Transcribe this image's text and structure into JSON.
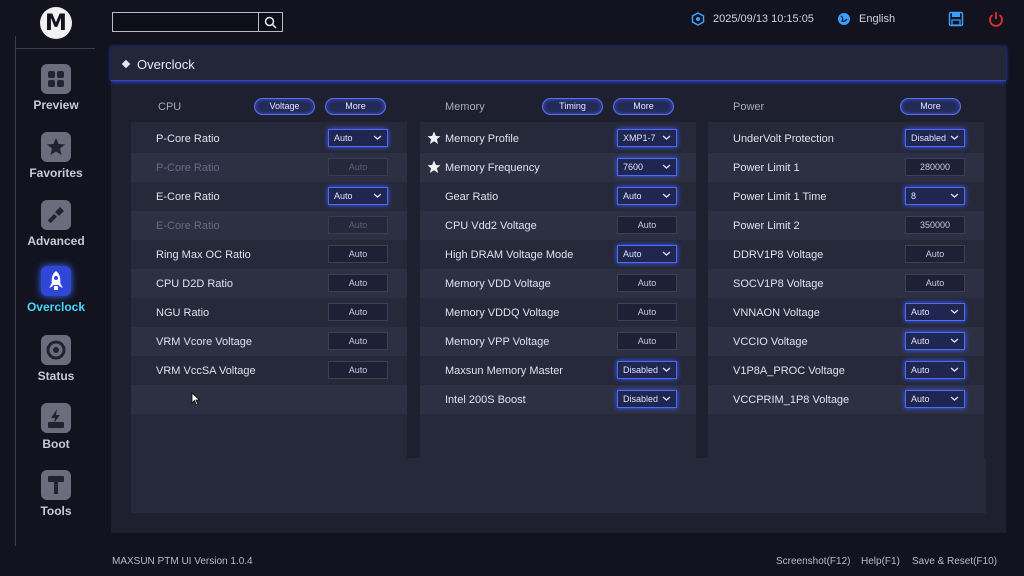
{
  "logo": "M",
  "sidebar": {
    "items": [
      {
        "label": "Preview",
        "icon": "grid-icon"
      },
      {
        "label": "Favorites",
        "icon": "star-icon"
      },
      {
        "label": "Advanced",
        "icon": "wrench-icon"
      },
      {
        "label": "Overclock",
        "icon": "rocket-icon",
        "active": true
      },
      {
        "label": "Status",
        "icon": "gauge-icon"
      },
      {
        "label": "Boot",
        "icon": "ssd-icon"
      },
      {
        "label": "Tools",
        "icon": "tools-icon"
      }
    ]
  },
  "search": {
    "value": "",
    "placeholder": ""
  },
  "header": {
    "datetime": "2025/09/13 10:15:05",
    "language": "English"
  },
  "main": {
    "title": "Overclock"
  },
  "columns": {
    "cpu": {
      "title": "CPU",
      "buttons": [
        "Voltage",
        "More"
      ],
      "rows": [
        {
          "label": "P-Core Ratio",
          "value": "Auto",
          "type": "select",
          "dim": false
        },
        {
          "label": "P-Core Ratio",
          "value": "Auto",
          "type": "field",
          "dim": true
        },
        {
          "label": "E-Core Ratio",
          "value": "Auto",
          "type": "select",
          "dim": false
        },
        {
          "label": "E-Core Ratio",
          "value": "Auto",
          "type": "field",
          "dim": true
        },
        {
          "label": "Ring Max OC Ratio",
          "value": "Auto",
          "type": "field",
          "dim": false
        },
        {
          "label": "CPU D2D Ratio",
          "value": "Auto",
          "type": "field",
          "dim": false
        },
        {
          "label": "NGU Ratio",
          "value": "Auto",
          "type": "field",
          "dim": false
        },
        {
          "label": "VRM Vcore Voltage",
          "value": "Auto",
          "type": "field",
          "dim": false
        },
        {
          "label": "VRM VccSA Voltage",
          "value": "Auto",
          "type": "field",
          "dim": false
        }
      ]
    },
    "memory": {
      "title": "Memory",
      "buttons": [
        "Timing",
        "More"
      ],
      "rows": [
        {
          "label": "Memory Profile",
          "value": "XMP1-7",
          "type": "select",
          "star": true
        },
        {
          "label": "Memory Frequency",
          "value": "7600",
          "type": "select",
          "star": true
        },
        {
          "label": "Gear Ratio",
          "value": "Auto",
          "type": "select"
        },
        {
          "label": "CPU Vdd2 Voltage",
          "value": "Auto",
          "type": "field"
        },
        {
          "label": "High DRAM Voltage Mode",
          "value": "Auto",
          "type": "select"
        },
        {
          "label": "Memory VDD Voltage",
          "value": "Auto",
          "type": "field"
        },
        {
          "label": "Memory VDDQ Voltage",
          "value": "Auto",
          "type": "field"
        },
        {
          "label": "Memory VPP Voltage",
          "value": "Auto",
          "type": "field"
        },
        {
          "label": "Maxsun Memory Master",
          "value": "Disabled",
          "type": "select"
        },
        {
          "label": "Intel 200S Boost",
          "value": "Disabled",
          "type": "select"
        }
      ]
    },
    "power": {
      "title": "Power",
      "buttons": [
        "More"
      ],
      "rows": [
        {
          "label": "UnderVolt Protection",
          "value": "Disabled",
          "type": "select"
        },
        {
          "label": "Power Limit 1",
          "value": "280000",
          "type": "field"
        },
        {
          "label": "Power Limit 1 Time",
          "value": "8",
          "type": "select"
        },
        {
          "label": "Power Limit 2",
          "value": "350000",
          "type": "field"
        },
        {
          "label": "DDRV1P8 Voltage",
          "value": "Auto",
          "type": "field"
        },
        {
          "label": "SOCV1P8 Voltage",
          "value": "Auto",
          "type": "field"
        },
        {
          "label": "VNNAON Voltage",
          "value": "Auto",
          "type": "select"
        },
        {
          "label": "VCCIO Voltage",
          "value": "Auto",
          "type": "select"
        },
        {
          "label": "V1P8A_PROC Voltage",
          "value": "Auto",
          "type": "select"
        },
        {
          "label": "VCCPRIM_1P8 Voltage",
          "value": "Auto",
          "type": "select"
        }
      ]
    }
  },
  "footer": {
    "version": "MAXSUN PTM UI Version 1.0.4",
    "screenshot": "Screenshot(F12)",
    "help": "Help(F1)",
    "save_reset": "Save & Reset(F10)"
  },
  "colors": {
    "accent": "#4a6cff",
    "active_label": "#45d7ff",
    "power_icon": "#e0302f",
    "save_icon": "#3aa0ff"
  }
}
